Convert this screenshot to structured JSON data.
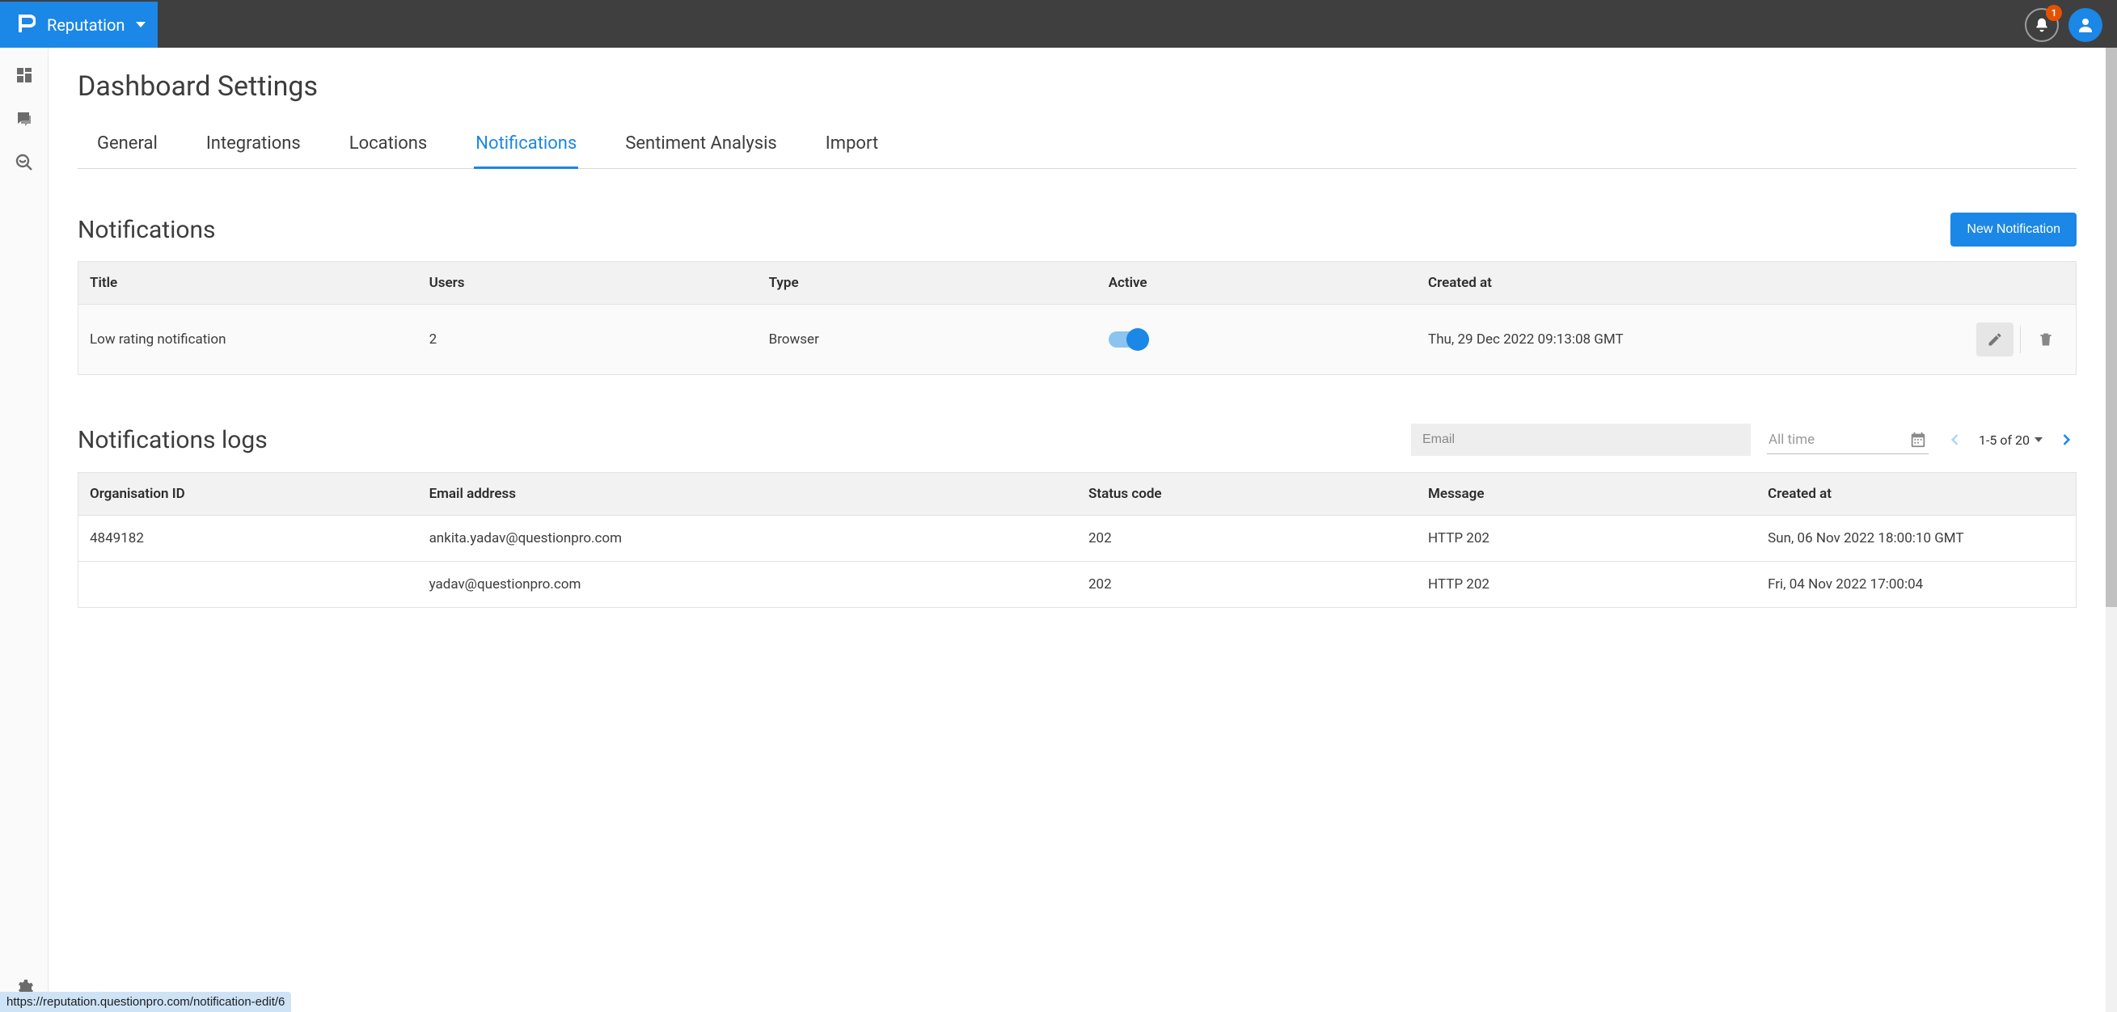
{
  "brand": {
    "label": "Reputation"
  },
  "notifications_badge": "1",
  "page": {
    "title": "Dashboard Settings"
  },
  "tabs": [
    {
      "label": "General",
      "active": false
    },
    {
      "label": "Integrations",
      "active": false
    },
    {
      "label": "Locations",
      "active": false
    },
    {
      "label": "Notifications",
      "active": true
    },
    {
      "label": "Sentiment Analysis",
      "active": false
    },
    {
      "label": "Import",
      "active": false
    }
  ],
  "notifications_section": {
    "title": "Notifications",
    "new_button": "New Notification",
    "columns": {
      "title": "Title",
      "users": "Users",
      "type": "Type",
      "active": "Active",
      "created_at": "Created at"
    },
    "rows": [
      {
        "title": "Low rating notification",
        "users": "2",
        "type": "Browser",
        "active": true,
        "created_at": "Thu, 29 Dec 2022 09:13:08 GMT"
      }
    ]
  },
  "logs_section": {
    "title": "Notifications logs",
    "email_placeholder": "Email",
    "date_filter": "All time",
    "pager": "1-5 of 20",
    "columns": {
      "org_id": "Organisation ID",
      "email": "Email address",
      "status": "Status code",
      "message": "Message",
      "created_at": "Created at"
    },
    "rows": [
      {
        "org_id": "4849182",
        "email": "ankita.yadav@questionpro.com",
        "status": "202",
        "message": "HTTP 202",
        "created_at": "Sun, 06 Nov 2022 18:00:10 GMT"
      },
      {
        "org_id": "",
        "email": "yadav@questionpro.com",
        "status": "202",
        "message": "HTTP 202",
        "created_at": "Fri, 04 Nov 2022 17:00:04"
      }
    ]
  },
  "status_url": "https://reputation.questionpro.com/notification-edit/6"
}
